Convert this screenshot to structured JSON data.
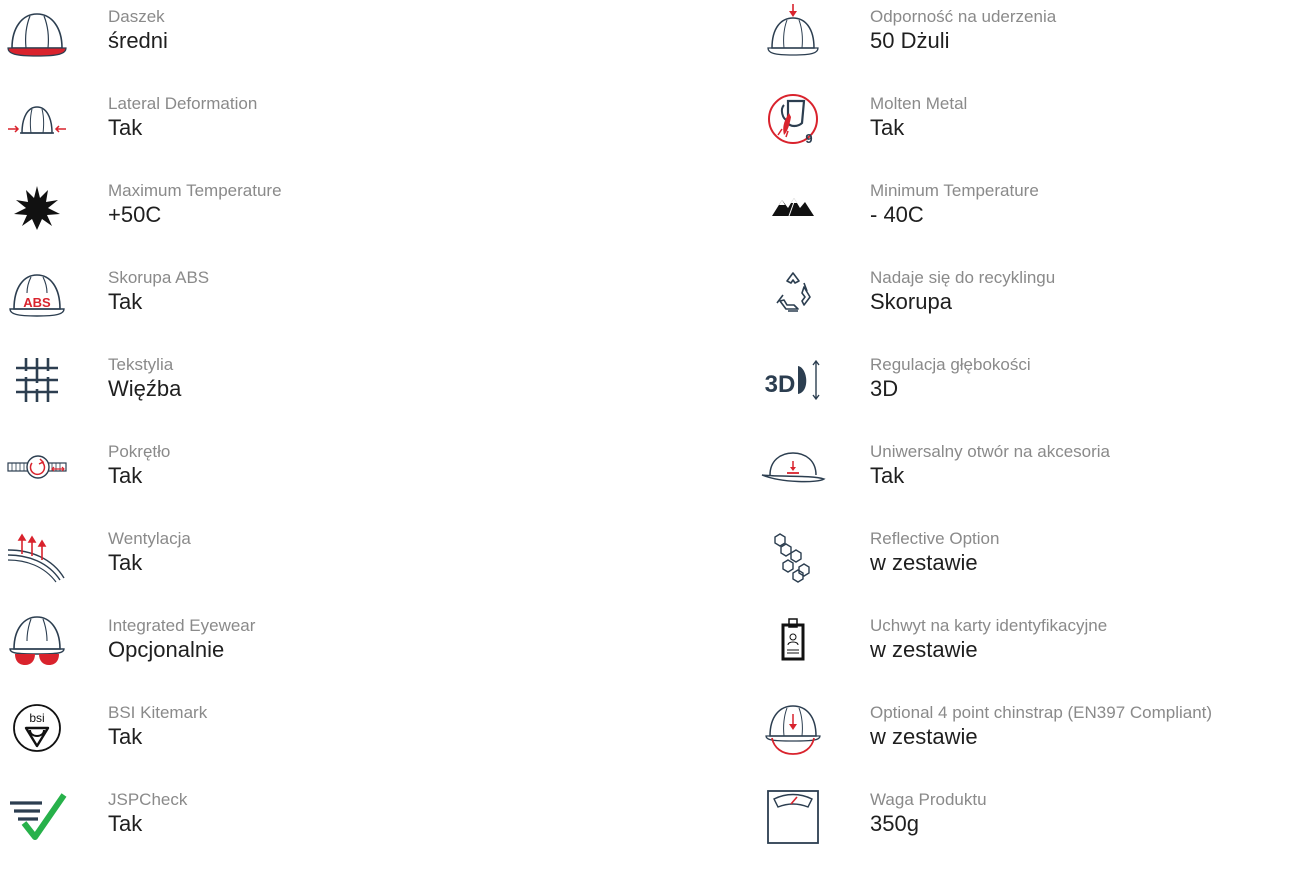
{
  "colors": {
    "label": "#8a8a8a",
    "value": "#1f1f1f",
    "icon_dark": "#2c3e50",
    "icon_red": "#d9232d",
    "icon_green": "#27b14a"
  },
  "left": [
    {
      "icon": "helmet-peak-icon",
      "label": "Daszek",
      "value": "średni"
    },
    {
      "icon": "lateral-deformation-icon",
      "label": "Lateral Deformation",
      "value": "Tak"
    },
    {
      "icon": "sun-icon",
      "label": "Maximum Temperature",
      "value": "+50C"
    },
    {
      "icon": "abs-shell-icon",
      "label": "Skorupa ABS",
      "value": "Tak",
      "icon_text": "ABS"
    },
    {
      "icon": "textile-grid-icon",
      "label": "Tekstylia",
      "value": "Więźba"
    },
    {
      "icon": "dial-ratchet-icon",
      "label": "Pokrętło",
      "value": "Tak"
    },
    {
      "icon": "ventilation-icon",
      "label": "Wentylacja",
      "value": "Tak"
    },
    {
      "icon": "integrated-eyewear-icon",
      "label": "Integrated Eyewear",
      "value": "Opcjonalnie"
    },
    {
      "icon": "bsi-kitemark-icon",
      "label": "BSI Kitemark",
      "value": "Tak",
      "icon_text": "bsi"
    },
    {
      "icon": "jspcheck-icon",
      "label": "JSPCheck",
      "value": "Tak"
    }
  ],
  "right": [
    {
      "icon": "impact-resistance-icon",
      "label": "Odporność na uderzenia",
      "value": "50 Dżuli"
    },
    {
      "icon": "molten-metal-icon",
      "label": "Molten Metal",
      "value": "Tak",
      "icon_text": "9"
    },
    {
      "icon": "mountains-icon",
      "label": "Minimum Temperature",
      "value": "- 40C"
    },
    {
      "icon": "recycle-icon",
      "label": "Nadaje się do recyklingu",
      "value": "Skorupa"
    },
    {
      "icon": "depth-adjust-3d-icon",
      "label": "Regulacja głębokości",
      "value": "3D",
      "icon_text": "3D"
    },
    {
      "icon": "accessory-slot-icon",
      "label": "Uniwersalny otwór na akcesoria",
      "value": "Tak"
    },
    {
      "icon": "reflective-hexagons-icon",
      "label": "Reflective Option",
      "value": "w zestawie"
    },
    {
      "icon": "id-card-holder-icon",
      "label": "Uchwyt na karty identyfikacyjne",
      "value": "w zestawie"
    },
    {
      "icon": "chinstrap-icon",
      "label": "Optional 4 point chinstrap (EN397 Compliant)",
      "value": "w zestawie"
    },
    {
      "icon": "weight-scale-icon",
      "label": "Waga Produktu",
      "value": "350g"
    }
  ]
}
